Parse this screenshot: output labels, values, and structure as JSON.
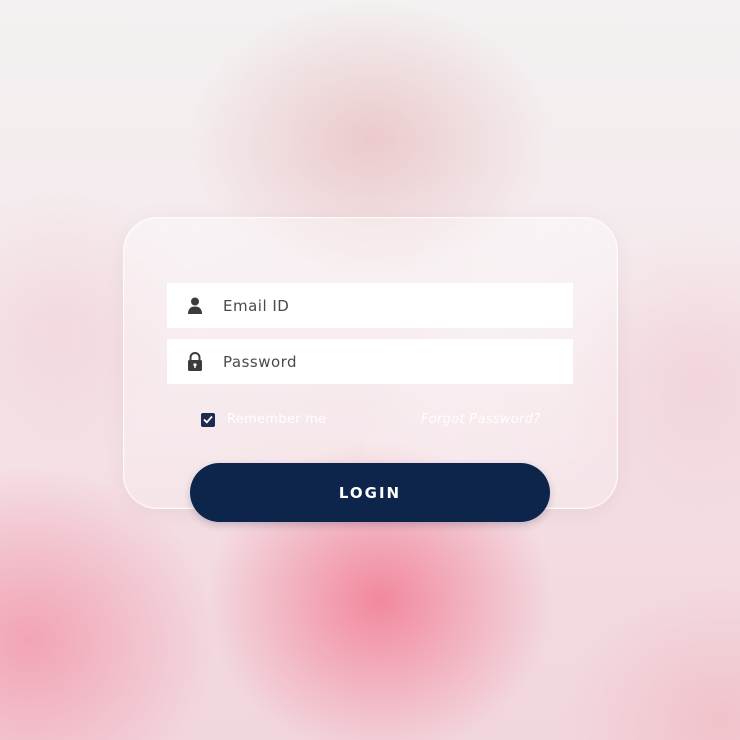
{
  "login_form": {
    "email": {
      "placeholder": "Email ID",
      "value": "",
      "icon": "user-icon"
    },
    "password": {
      "placeholder": "Password",
      "value": "",
      "icon": "lock-icon"
    },
    "remember_me": {
      "label": "Remember me",
      "checked": true
    },
    "forgot_password_label": "Forgot Password?",
    "login_label": "LOGIN"
  },
  "colors": {
    "button": "#0d244b",
    "checkbox": "#1c2b4f",
    "field_bg": "#ffffff",
    "accent_pink": "#f17a92"
  }
}
